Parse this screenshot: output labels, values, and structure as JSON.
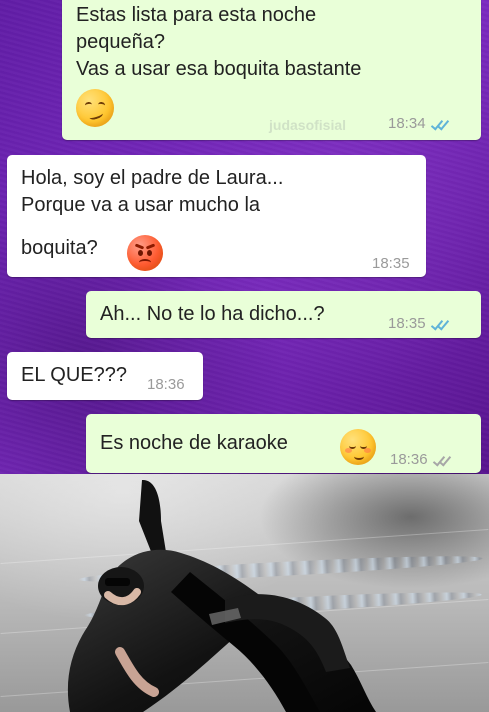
{
  "conversation": {
    "messages": [
      {
        "type": "sent",
        "lines": [
          "Estas lista para esta noche",
          "pequeña?",
          "Vas a usar esa boquita bastante"
        ],
        "time": "18:34",
        "emoji": "smirking-face-icon"
      },
      {
        "type": "received",
        "lines": [
          "Hola, soy el padre de Laura...",
          "Porque va a usar mucho la",
          "boquita?"
        ],
        "time": "18:35",
        "emoji": "angry-face-icon"
      },
      {
        "type": "sent",
        "lines": [
          "Ah... No te lo ha dicho...?"
        ],
        "time": "18:35",
        "status": "read"
      },
      {
        "type": "received",
        "lines": [
          "EL QUE???"
        ],
        "time": "18:36"
      },
      {
        "type": "sent",
        "lines": [
          "Es noche de karaoke"
        ],
        "time": "18:36",
        "emoji": "smiling-blushing-face-icon",
        "status": "delivered"
      }
    ],
    "watermark": "judasofisial"
  },
  "image": {
    "description_icon": "matrix-dodge-photo-icon"
  },
  "colors": {
    "chat_background": "#6a23b0",
    "sent_bubble": "#e9ffd8",
    "received_bubble": "#ffffff",
    "read_tick": "#5fb3d8",
    "delivered_tick": "#a7a7a7"
  }
}
